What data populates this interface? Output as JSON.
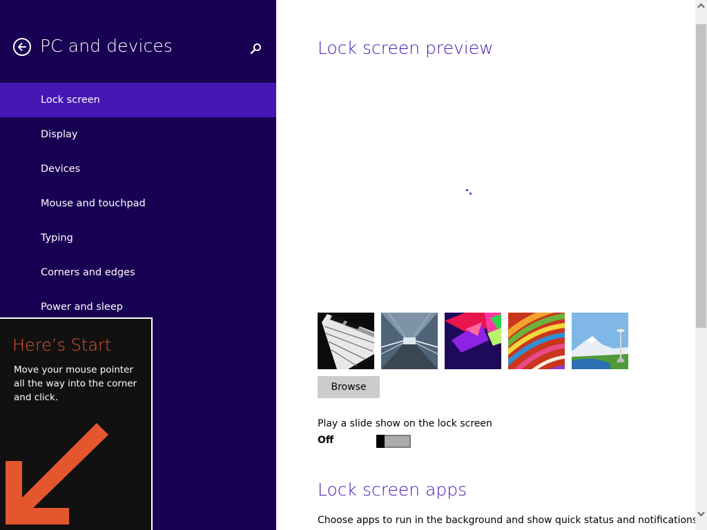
{
  "nav": {
    "title": "PC and devices",
    "items": [
      {
        "label": "Lock screen",
        "selected": true
      },
      {
        "label": "Display"
      },
      {
        "label": "Devices"
      },
      {
        "label": "Mouse and touchpad"
      },
      {
        "label": "Typing"
      },
      {
        "label": "Corners and edges"
      },
      {
        "label": "Power and sleep"
      }
    ]
  },
  "tip": {
    "title": "Here’s Start",
    "body": "Move your mouse pointer all the way into the corner and click."
  },
  "content": {
    "preview_heading": "Lock screen preview",
    "browse_label": "Browse",
    "slideshow_label": "Play a slide show on the lock screen",
    "slideshow_state": "Off",
    "apps_heading": "Lock screen apps",
    "apps_description": "Choose apps to run in the background and show quick status and notifications,"
  },
  "icons": {
    "back": "back-arrow-icon",
    "search": "search-icon",
    "loading": "loading-spinner-icon",
    "tip_arrow": "arrow-down-left-icon"
  },
  "colors": {
    "nav_background": "#180052",
    "nav_selected": "#4617b4",
    "accent": "#4617b4",
    "tip_title": "#e4572e",
    "tip_arrow": "#e4572e"
  }
}
